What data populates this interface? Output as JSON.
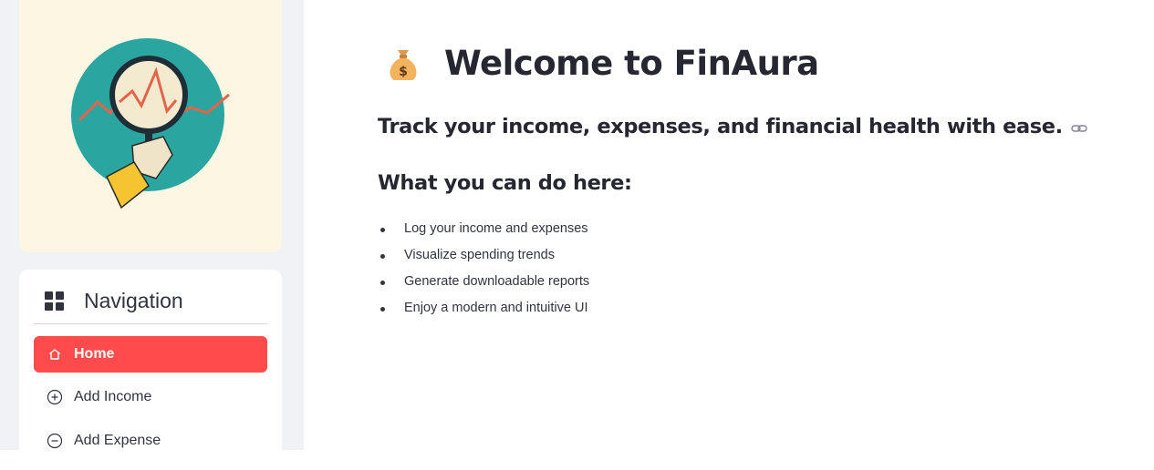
{
  "sidebar": {
    "nav": {
      "title": "Navigation",
      "icon": "grid-icon",
      "items": [
        {
          "label": "Home",
          "icon": "home-icon",
          "active": true
        },
        {
          "label": "Add Income",
          "icon": "plus-circle-icon",
          "active": false
        },
        {
          "label": "Add Expense",
          "icon": "minus-circle-icon",
          "active": false
        }
      ]
    }
  },
  "main": {
    "title_emoji": "money-bag-icon",
    "title": "Welcome to FinAura",
    "subtitle": "Track your income, expenses, and financial health with ease.",
    "section_title": "What you can do here:",
    "features": [
      "Log your income and expenses",
      "Visualize spending trends",
      "Generate downloadable reports",
      "Enjoy a modern and intuitive UI"
    ]
  },
  "colors": {
    "accent": "#ff4b4b",
    "sidebar_bg": "#f0f2f6",
    "illustration_bg": "#fdf6e3",
    "teal": "#2aa59f"
  }
}
